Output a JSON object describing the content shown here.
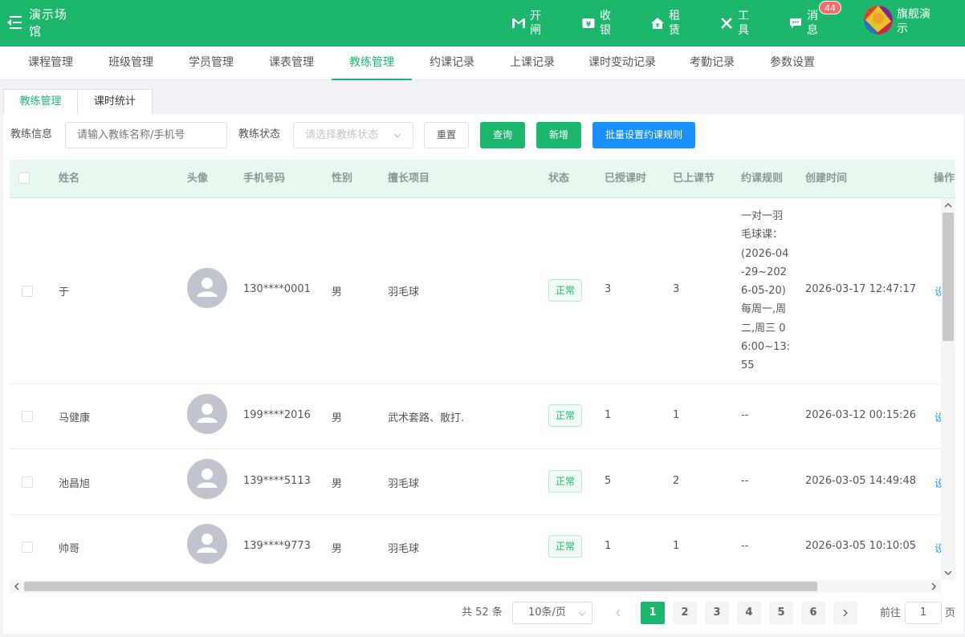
{
  "header": {
    "app_title": "演示场馆",
    "tools": [
      {
        "label": "开闸",
        "icon": "gate-icon"
      },
      {
        "label": "收银",
        "icon": "cashier-icon"
      },
      {
        "label": "租赁",
        "icon": "rental-icon"
      },
      {
        "label": "工具",
        "icon": "tools-icon"
      },
      {
        "label": "消息",
        "icon": "message-icon"
      }
    ],
    "message_badge": "44",
    "user_name": "旗舰演示"
  },
  "nav": {
    "items": [
      "课程管理",
      "班级管理",
      "学员管理",
      "课表管理",
      "教练管理",
      "约课记录",
      "上课记录",
      "课时变动记录",
      "考勤记录",
      "参数设置"
    ],
    "active": "教练管理"
  },
  "subtabs": [
    "教练管理",
    "课时统计"
  ],
  "filters": {
    "info_label": "教练信息",
    "info_placeholder": "请输入教练名称/手机号",
    "status_label": "教练状态",
    "status_placeholder": "请选择教练状态",
    "reset": "重置",
    "query": "查询",
    "add": "新增",
    "batch": "批量设置约课规则"
  },
  "table": {
    "columns": [
      "姓名",
      "头像",
      "手机号码",
      "性别",
      "擅长项目",
      "状态",
      "已授课时",
      "已上课节",
      "约课规则",
      "创建时间",
      "操作"
    ],
    "rows": [
      {
        "name": "于",
        "phone": "130****0001",
        "gender": "男",
        "skill": "羽毛球",
        "status": "正常",
        "taught": "3",
        "lessons": "3",
        "rule": "一对一羽毛球课：(2026-04-29~2026-05-20) 每周一,周二,周三 06:00~13:55",
        "created": "2026-03-17 12:47:17",
        "op": "设"
      },
      {
        "name": "马健康",
        "phone": "199****2016",
        "gender": "男",
        "skill": "武术套路、散打.",
        "status": "正常",
        "taught": "1",
        "lessons": "1",
        "rule": "--",
        "created": "2026-03-12 00:15:26",
        "op": "设"
      },
      {
        "name": "池昌旭",
        "phone": "139****5113",
        "gender": "男",
        "skill": "羽毛球",
        "status": "正常",
        "taught": "5",
        "lessons": "2",
        "rule": "--",
        "created": "2026-03-05 14:49:48",
        "op": "设"
      },
      {
        "name": "帅哥",
        "phone": "139****9773",
        "gender": "男",
        "skill": "羽毛球",
        "status": "正常",
        "taught": "1",
        "lessons": "1",
        "rule": "--",
        "created": "2026-03-05 10:10:05",
        "op": "设"
      }
    ]
  },
  "pagination": {
    "total": "共 52 条",
    "page_size": "10条/页",
    "pages": [
      "1",
      "2",
      "3",
      "4",
      "5",
      "6"
    ],
    "current": "1",
    "goto_prefix": "前往",
    "goto_value": "1",
    "goto_suffix": "页"
  },
  "colors": {
    "primary": "#1cb76c",
    "blue": "#1890ff",
    "badge": "#f56c6c"
  }
}
